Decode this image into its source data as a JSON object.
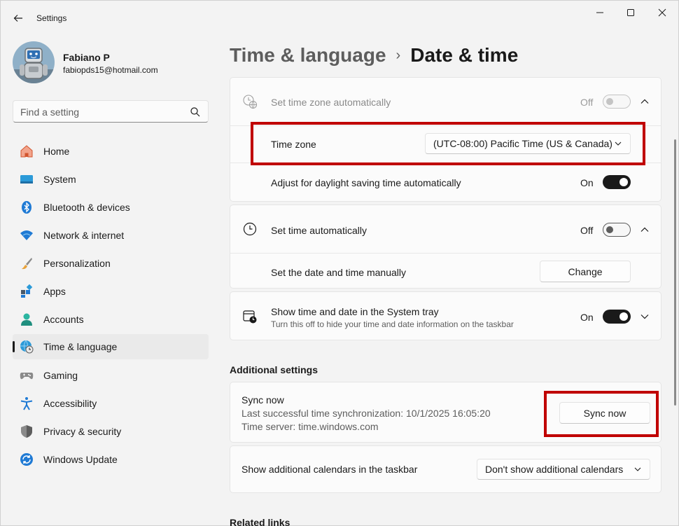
{
  "app": {
    "title": "Settings"
  },
  "profile": {
    "name": "Fabiano P",
    "email": "fabiopds15@hotmail.com"
  },
  "search": {
    "placeholder": "Find a setting"
  },
  "sidebar": {
    "items": [
      {
        "label": "Home",
        "icon": "home-icon"
      },
      {
        "label": "System",
        "icon": "system-icon"
      },
      {
        "label": "Bluetooth & devices",
        "icon": "bluetooth-icon"
      },
      {
        "label": "Network & internet",
        "icon": "wifi-icon"
      },
      {
        "label": "Personalization",
        "icon": "brush-icon"
      },
      {
        "label": "Apps",
        "icon": "apps-icon"
      },
      {
        "label": "Accounts",
        "icon": "accounts-icon"
      },
      {
        "label": "Time & language",
        "icon": "globe-clock-icon",
        "active": true
      },
      {
        "label": "Gaming",
        "icon": "gamepad-icon"
      },
      {
        "label": "Accessibility",
        "icon": "accessibility-icon"
      },
      {
        "label": "Privacy & security",
        "icon": "shield-icon"
      },
      {
        "label": "Windows Update",
        "icon": "update-icon"
      }
    ]
  },
  "breadcrumb": {
    "parent": "Time & language",
    "separator": "›",
    "current": "Date & time"
  },
  "timezone_card": {
    "auto_label": "Set time zone automatically",
    "auto_state": "Off",
    "timezone_label": "Time zone",
    "timezone_value": "(UTC-08:00) Pacific Time (US & Canada)",
    "dst_label": "Adjust for daylight saving time automatically",
    "dst_state": "On"
  },
  "time_card": {
    "auto_label": "Set time automatically",
    "auto_state": "Off",
    "manual_label": "Set the date and time manually",
    "change_button": "Change"
  },
  "tray_card": {
    "label": "Show time and date in the System tray",
    "sublabel": "Turn this off to hide your time and date information on the taskbar",
    "state": "On"
  },
  "additional": {
    "title": "Additional settings",
    "sync_title": "Sync now",
    "sync_last": "Last successful time synchronization: 10/1/2025 16:05:20",
    "sync_server": "Time server: time.windows.com",
    "sync_button": "Sync now",
    "calendars_label": "Show additional calendars in the taskbar",
    "calendars_value": "Don't show additional calendars"
  },
  "related": {
    "title": "Related links"
  },
  "colors": {
    "accent": "#1a1a1a",
    "highlight": "#c00000",
    "window_bg": "#f3f3f3",
    "card_bg": "#fbfbfb"
  }
}
